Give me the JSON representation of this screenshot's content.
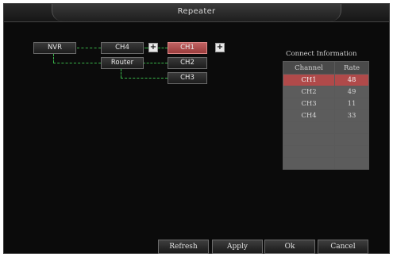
{
  "window": {
    "title": "Repeater"
  },
  "topology": {
    "nvr": "NVR",
    "router": "Router",
    "ch4": "CH4",
    "ch1": "CH1",
    "ch2": "CH2",
    "ch3": "CH3",
    "expand_glyph": "+"
  },
  "connect_info": {
    "title": "Connect Information",
    "headers": [
      "Channel",
      "Rate"
    ],
    "rows": [
      {
        "channel": "CH1",
        "rate": "48"
      },
      {
        "channel": "CH2",
        "rate": "49"
      },
      {
        "channel": "CH3",
        "rate": "11"
      },
      {
        "channel": "CH4",
        "rate": "33"
      },
      {
        "channel": "",
        "rate": ""
      },
      {
        "channel": "",
        "rate": ""
      },
      {
        "channel": "",
        "rate": ""
      },
      {
        "channel": "",
        "rate": ""
      }
    ]
  },
  "buttons": {
    "refresh": "Refresh",
    "apply": "Apply",
    "ok": "Ok",
    "cancel": "Cancel"
  },
  "colors": {
    "selected": "#b04a4a",
    "link_line": "#39b54a"
  }
}
